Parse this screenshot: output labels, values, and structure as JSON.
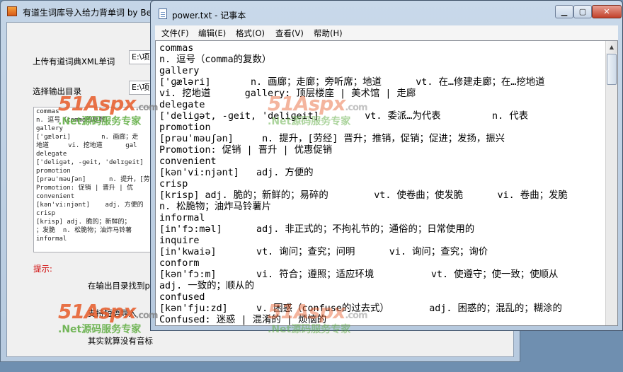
{
  "app": {
    "title": "有道生词库导入给力背单词  by Be",
    "upload_label": "上传有道词典XML单词",
    "upload_path": "E:\\项",
    "output_label": "选择输出目录",
    "output_path": "E:\\项",
    "preview_lines": [
      "commas",
      "n. 逗号（comma的复数）",
      "gallery",
      "['ɡæləri]        n. 画廊；走",
      "地道     vi. 挖地道      gal",
      "delegate",
      "['deliɡət, -ɡeit, 'delɪɡeit]",
      "promotion",
      "[prəu'məuʃən]      n. 提升，[劳",
      "Promotion: 促销 | 晋升 | 优",
      "convenient",
      "[kən'vi:njənt]    adj. 方便的",
      "crisp",
      "[krisp] adj. 脆的；新鲜的；",
      "；发脆  n. 松脆物；油炸马铃薯",
      "informal"
    ],
    "tip_label": "提示:",
    "tip_lines": [
      "在输出目录找到p",
      "支持短语导入",
      "其实就算没有音标"
    ]
  },
  "notepad": {
    "title": "power.txt - 记事本",
    "menu": [
      "文件(F)",
      "编辑(E)",
      "格式(O)",
      "查看(V)",
      "帮助(H)"
    ],
    "lines": [
      "commas",
      "n. 逗号（comma的复数）",
      "gallery",
      "['ɡæləri]       n. 画廊；走廊；旁听席；地道      vt. 在…修建走廊；在…挖地道",
      "vi. 挖地道      gallery: 顶层楼座 | 美术馆 | 走廊",
      "delegate",
      "['deliɡət, -ɡeit, 'deliɡeit]        vt. 委派…为代表         n. 代表",
      "promotion",
      "[prəu'məuʃən]     n. 提升，[劳经] 晋升；推销，促销；促进；发扬，振兴",
      "Promotion: 促销 | 晋升 | 优惠促销",
      "convenient",
      "[kən'vi:njənt]   adj. 方便的",
      "crisp",
      "[krisp] adj. 脆的；新鲜的；易碎的        vt. 使卷曲；使发脆      vi. 卷曲；发脆",
      "n. 松脆物；油炸马铃薯片",
      "informal",
      "[in'fɔ:məl]      adj. 非正式的；不拘礼节的；通俗的；日常使用的",
      "inquire",
      "[in'kwaiə]       vt. 询问；查究；问明      vi. 询问；查究；询价",
      "conform",
      "[kən'fɔ:m]       vi. 符合；遵照；适应环境          vt. 使遵守；使一致；使顺从",
      "adj. 一致的；顺从的",
      "confused",
      "[kən'fju:zd]     v. 困惑（confuse的过去式）       adj. 困惑的；混乱的；糊涂的",
      "Confused: 迷惑 | 混淆的 | 烦恼的"
    ]
  },
  "watermark": {
    "logo": "51Aspx",
    "domain": ".com",
    "slogan": ".Net源码服务专家"
  },
  "colors": {
    "tip_label": "#d00000",
    "close_button": "#c2412a"
  },
  "icons": [
    "app-icon",
    "notepad-icon",
    "minimize-icon",
    "maximize-icon",
    "close-icon",
    "scroll-up-icon"
  ]
}
